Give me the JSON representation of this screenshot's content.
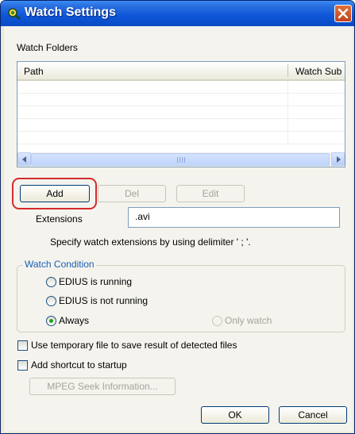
{
  "window": {
    "title": "Watch Settings"
  },
  "folders": {
    "label": "Watch Folders",
    "columns": [
      "Path",
      "Watch Sub"
    ],
    "rows": []
  },
  "buttons": {
    "add": "Add",
    "del": "Del",
    "edit": "Edit",
    "mpeg": "MPEG Seek Information...",
    "ok": "OK",
    "cancel": "Cancel"
  },
  "extensions": {
    "label": "Extensions",
    "value": ".avi",
    "hint": "Specify watch extensions by using delimiter ' ; '."
  },
  "watch_condition": {
    "label": "Watch Condition",
    "options": [
      "EDIUS is running",
      "EDIUS is not running",
      "Always"
    ],
    "selected": "Always",
    "only_watch": "Only watch"
  },
  "checkboxes": {
    "temp_file": "Use temporary file to save result of detected files",
    "startup": "Add shortcut to startup"
  },
  "colors": {
    "highlight": "#d52b2b",
    "titlebar": "#0d55d8",
    "group_title": "#1c5fb0"
  }
}
